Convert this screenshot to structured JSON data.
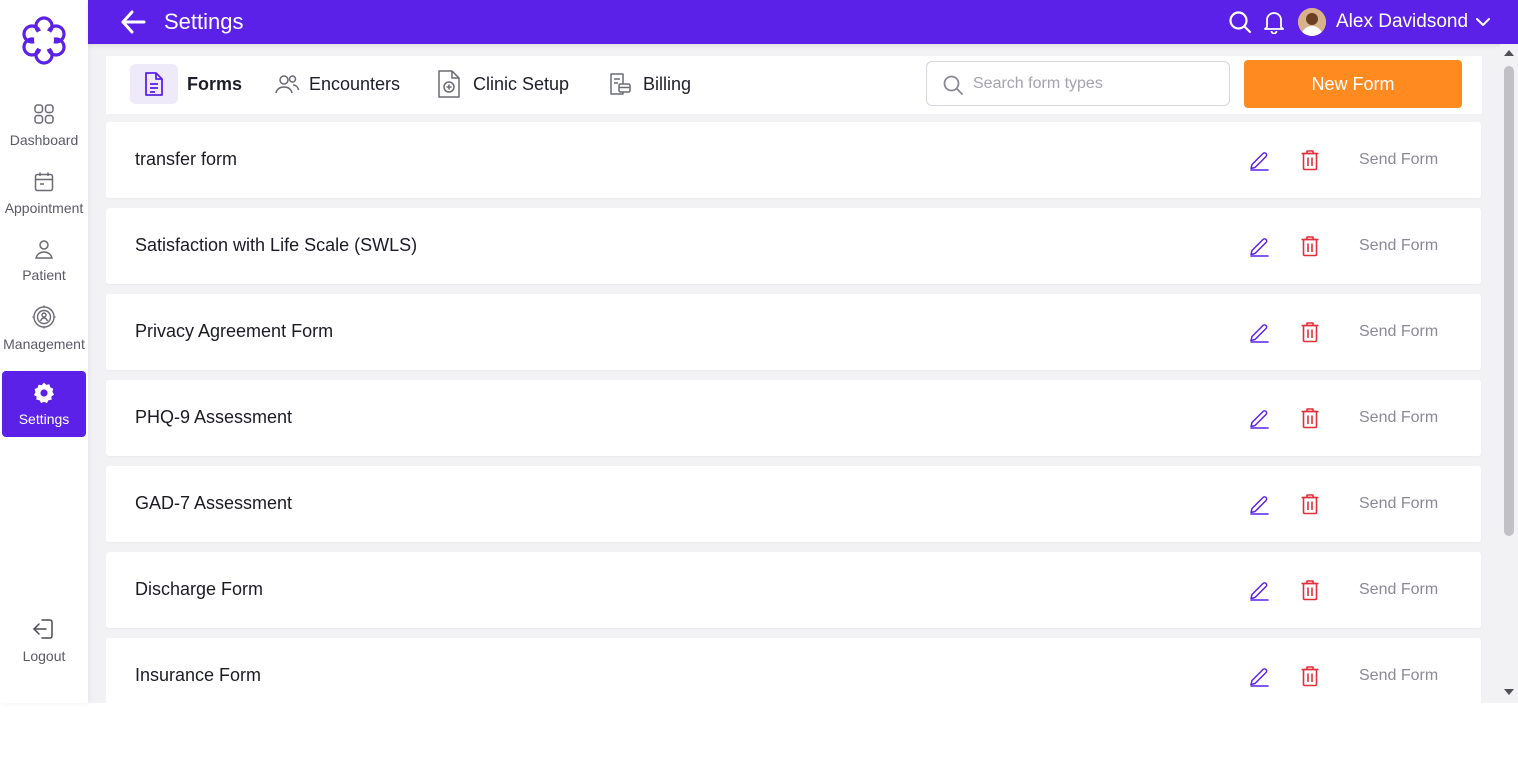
{
  "colors": {
    "brand": "#5b21e8",
    "accent_orange": "#ff8a1f",
    "delete_red": "#e0313a",
    "edit_purple": "#5b21e8"
  },
  "sidebar": {
    "items": [
      {
        "label": "Dashboard",
        "icon": "grid-icon",
        "active": false
      },
      {
        "label": "Appointment",
        "icon": "calendar-icon",
        "active": false
      },
      {
        "label": "Patient",
        "icon": "person-icon",
        "active": false
      },
      {
        "label": "Management",
        "icon": "management-icon",
        "active": false
      },
      {
        "label": "Settings",
        "icon": "gear-icon",
        "active": true
      }
    ],
    "logout_label": "Logout"
  },
  "header": {
    "title": "Settings",
    "user_name": "Alex Davidsond"
  },
  "tabs": [
    {
      "label": "Forms",
      "icon": "document-icon",
      "active": true
    },
    {
      "label": "Encounters",
      "icon": "users-icon",
      "active": false
    },
    {
      "label": "Clinic Setup",
      "icon": "medical-file-icon",
      "active": false
    },
    {
      "label": "Billing",
      "icon": "billing-icon",
      "active": false
    }
  ],
  "search": {
    "placeholder": "Search form types",
    "value": ""
  },
  "new_form_label": "New Form",
  "forms": [
    {
      "name": "transfer form",
      "action": "Send Form"
    },
    {
      "name": "Satisfaction with Life Scale (SWLS)",
      "action": "Send Form"
    },
    {
      "name": "Privacy Agreement Form",
      "action": "Send Form"
    },
    {
      "name": "PHQ-9 Assessment",
      "action": "Send Form"
    },
    {
      "name": "GAD-7 Assessment",
      "action": "Send Form"
    },
    {
      "name": "Discharge Form",
      "action": "Send Form"
    },
    {
      "name": "Insurance Form",
      "action": "Send Form"
    }
  ]
}
